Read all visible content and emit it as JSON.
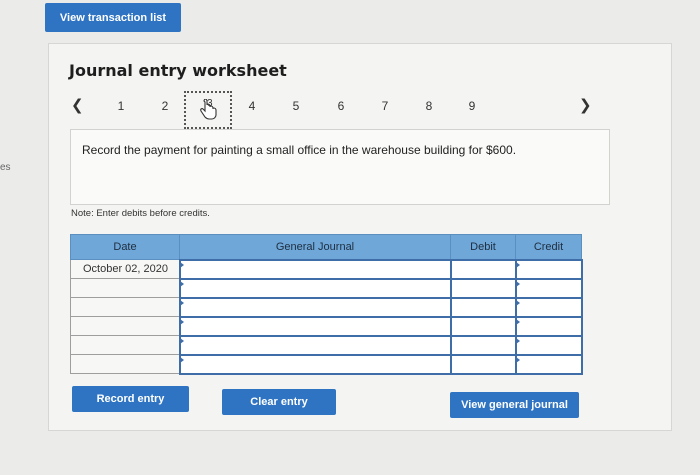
{
  "top": {
    "view_list_label": "View transaction list"
  },
  "side_text": "es",
  "worksheet": {
    "title": "Journal entry worksheet",
    "pager": {
      "prev_icon": "chevron-left-icon",
      "next_icon": "chevron-right-icon",
      "pages": [
        "1",
        "2",
        "3",
        "4",
        "5",
        "6",
        "7",
        "8",
        "9"
      ],
      "current_page": 3
    },
    "instruction": "Record the payment for painting a small office in the warehouse building for $600.",
    "note": "Note: Enter debits before credits."
  },
  "table": {
    "headers": [
      "Date",
      "General Journal",
      "Debit",
      "Credit"
    ],
    "rows": [
      [
        "October 02, 2020",
        "",
        "",
        ""
      ],
      [
        "",
        "",
        "",
        ""
      ],
      [
        "",
        "",
        "",
        ""
      ],
      [
        "",
        "",
        "",
        ""
      ],
      [
        "",
        "",
        "",
        ""
      ],
      [
        "",
        "",
        "",
        ""
      ]
    ]
  },
  "buttons": {
    "record": "Record entry",
    "clear": "Clear entry",
    "view_journal": "View general journal"
  },
  "colors": {
    "button_blue": "#2f74c3",
    "header_blue": "#6ea7d8",
    "input_border": "#3e6da7"
  }
}
